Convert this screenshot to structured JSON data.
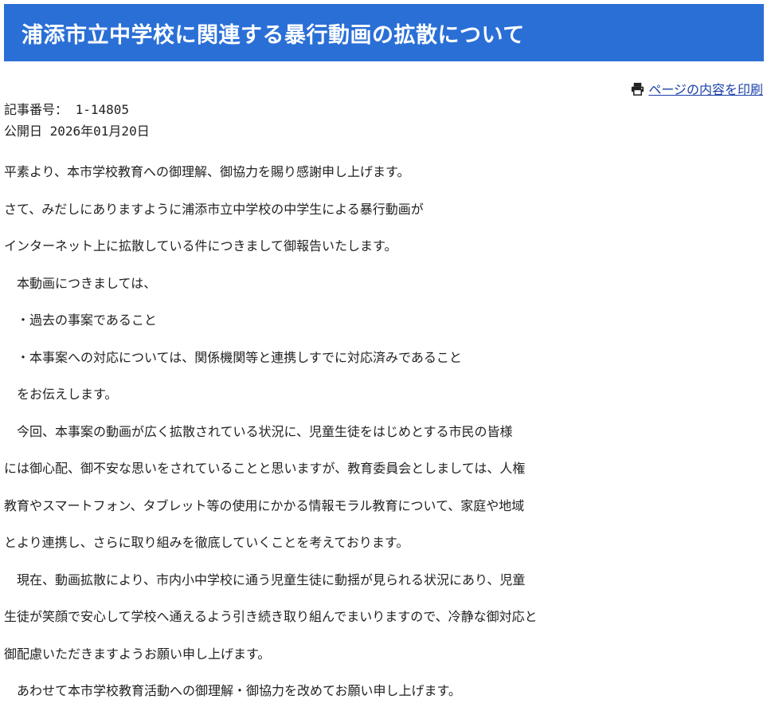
{
  "header": {
    "title": "浦添市立中学校に関連する暴行動画の拡散について"
  },
  "print": {
    "icon": "printer-icon",
    "label": "ページの内容を印刷"
  },
  "meta": {
    "article_number": "記事番号： 1-14805",
    "published": "公開日 2026年01月20日"
  },
  "body": {
    "lines": [
      "平素より、本市学校教育への御理解、御協力を賜り感謝申し上げます。",
      "さて、みだしにありますように浦添市立中学校の中学生による暴行動画が",
      "インターネット上に拡散している件につきまして御報告いたします。",
      "　本動画につきましては、",
      "　・過去の事案であること",
      "　・本事案への対応については、関係機関等と連携しすでに対応済みであること",
      "　をお伝えします。",
      "　今回、本事案の動画が広く拡散されている状況に、児童生徒をはじめとする市民の皆様",
      "には御心配、御不安な思いをされていることと思いますが、教育委員会としましては、人権",
      "教育やスマートフォン、タブレット等の使用にかかる情報モラル教育について、家庭や地域",
      "とより連携し、さらに取り組みを徹底していくことを考えております。",
      "　現在、動画拡散により、市内小中学校に通う児童生徒に動揺が見られる状況にあり、児童",
      "生徒が笑顔で安心して学校へ通えるよう引き続き取り組んでまいりますので、冷静な御対応と",
      "御配慮いただきますようお願い申し上げます。",
      "　あわせて本市学校教育活動への御理解・御協力を改めてお願い申し上げます。"
    ]
  },
  "colors": {
    "header_bg": "#2a6fd6",
    "header_text": "#ffffff",
    "link": "#1a3fa8",
    "body_text": "#222222"
  }
}
